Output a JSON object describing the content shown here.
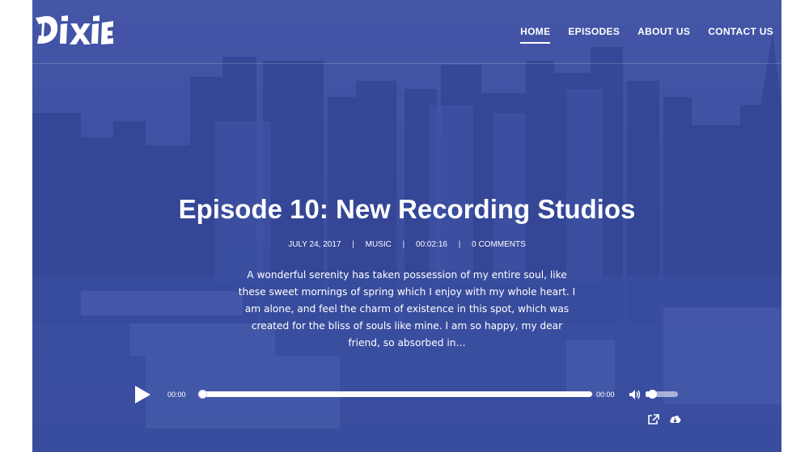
{
  "brand": {
    "logo_text": "DIXIE"
  },
  "nav": {
    "items": [
      {
        "label": "HOME",
        "active": true
      },
      {
        "label": "EPISODES",
        "active": false
      },
      {
        "label": "ABOUT US",
        "active": false
      },
      {
        "label": "CONTACT US",
        "active": false
      }
    ]
  },
  "episode": {
    "title": "Episode 10: New Recording Studios",
    "date": "JULY 24, 2017",
    "category": "MUSIC",
    "duration": "00:02:16",
    "comments": "0 COMMENTS",
    "excerpt": "A wonderful serenity has taken possession of my entire soul, like these sweet mornings of spring which I enjoy with my whole heart. I am alone, and feel the charm of existence in this spot, which was created for the bliss of souls like mine. I am so happy, my dear friend, so absorbed in…"
  },
  "player": {
    "current_time": "00:00",
    "duration_time": "00:00",
    "progress": 0,
    "volume": 0.1,
    "icons": {
      "play": "play-icon",
      "volume": "volume-icon",
      "share": "external-link-icon",
      "download": "cloud-download-icon"
    }
  },
  "colors": {
    "overlay": "#3d4fa5",
    "text": "#ffffff"
  }
}
